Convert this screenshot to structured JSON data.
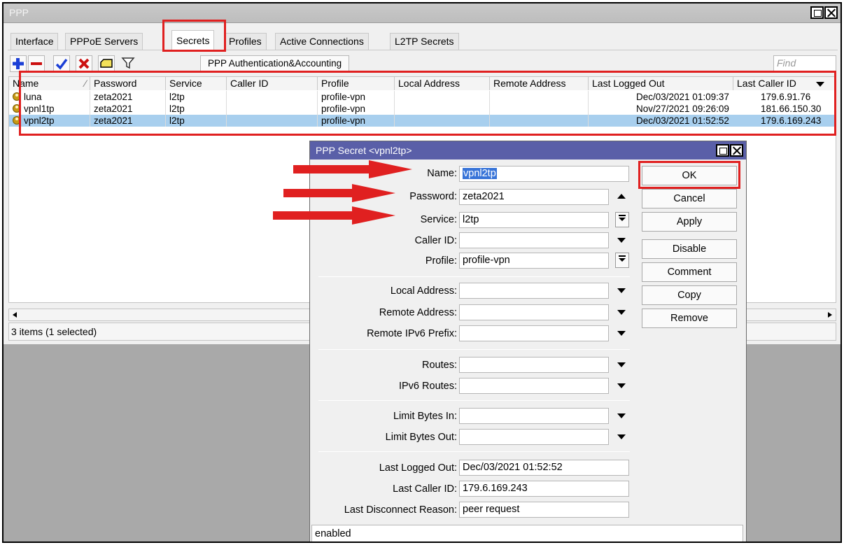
{
  "window": {
    "title": "PPP"
  },
  "tabs": [
    "Interface",
    "PPPoE Servers",
    "Secrets",
    "Profiles",
    "Active Connections",
    "L2TP Secrets"
  ],
  "toolbar": {
    "add_icon": "plus-icon",
    "remove_icon": "minus-icon",
    "enable_icon": "check-icon",
    "disable_icon": "x-icon",
    "comment_icon": "comment-icon",
    "filter_icon": "filter-icon",
    "auth_label": "PPP Authentication&Accounting",
    "find_placeholder": "Find"
  },
  "table": {
    "columns": [
      "Name",
      "Password",
      "Service",
      "Caller ID",
      "Profile",
      "Local Address",
      "Remote Address",
      "Last Logged Out",
      "Last Caller ID"
    ],
    "rows": [
      {
        "name": "luna",
        "password": "zeta2021",
        "service": "l2tp",
        "caller_id": "",
        "profile": "profile-vpn",
        "local": "",
        "remote": "",
        "last_logged_out": "Dec/03/2021 01:09:37",
        "last_caller_id": "179.6.91.76",
        "selected": false
      },
      {
        "name": "vpnl1tp",
        "password": "zeta2021",
        "service": "l2tp",
        "caller_id": "",
        "profile": "profile-vpn",
        "local": "",
        "remote": "",
        "last_logged_out": "Nov/27/2021 09:26:09",
        "last_caller_id": "181.66.150.30",
        "selected": false
      },
      {
        "name": "vpnl2tp",
        "password": "zeta2021",
        "service": "l2tp",
        "caller_id": "",
        "profile": "profile-vpn",
        "local": "",
        "remote": "",
        "last_logged_out": "Dec/03/2021 01:52:52",
        "last_caller_id": "179.6.169.243",
        "selected": true
      }
    ]
  },
  "status": "3 items (1 selected)",
  "dialog": {
    "title": "PPP Secret <vpnl2tp>",
    "fields": {
      "name": {
        "label": "Name:",
        "value": "vpnl2tp"
      },
      "password": {
        "label": "Password:",
        "value": "zeta2021"
      },
      "service": {
        "label": "Service:",
        "value": "l2tp"
      },
      "caller_id": {
        "label": "Caller ID:",
        "value": ""
      },
      "profile": {
        "label": "Profile:",
        "value": "profile-vpn"
      },
      "local_address": {
        "label": "Local Address:",
        "value": ""
      },
      "remote_address": {
        "label": "Remote Address:",
        "value": ""
      },
      "remote_ipv6_prefix": {
        "label": "Remote IPv6 Prefix:",
        "value": ""
      },
      "routes": {
        "label": "Routes:",
        "value": ""
      },
      "ipv6_routes": {
        "label": "IPv6 Routes:",
        "value": ""
      },
      "limit_bytes_in": {
        "label": "Limit Bytes In:",
        "value": ""
      },
      "limit_bytes_out": {
        "label": "Limit Bytes Out:",
        "value": ""
      },
      "last_logged_out": {
        "label": "Last Logged Out:",
        "value": "Dec/03/2021 01:52:52"
      },
      "last_caller_id": {
        "label": "Last Caller ID:",
        "value": "179.6.169.243"
      },
      "last_disconnect_reason": {
        "label": "Last Disconnect Reason:",
        "value": "peer request"
      }
    },
    "buttons": [
      "OK",
      "Cancel",
      "Apply",
      "Disable",
      "Comment",
      "Copy",
      "Remove"
    ],
    "status": "enabled"
  },
  "colors": {
    "highlight_red": "#e02020",
    "selected_row": "#a8cfee",
    "dialog_title_bg": "#5a5fa8"
  }
}
